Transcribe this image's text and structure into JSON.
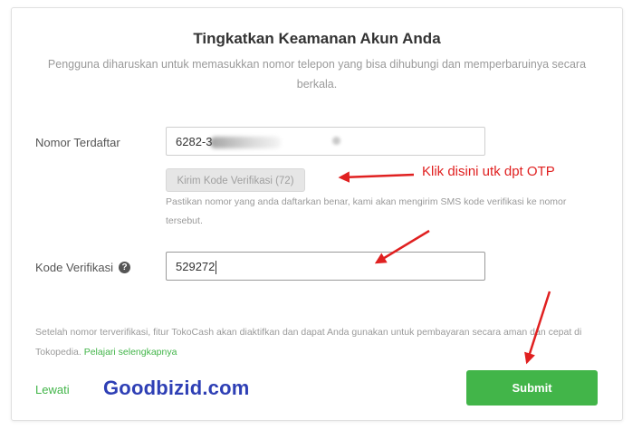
{
  "header": {
    "title": "Tingkatkan Keamanan Akun Anda",
    "subtitle": "Pengguna diharuskan untuk memasukkan nomor telepon yang bisa dihubungi dan memperbaruinya secara berkala."
  },
  "phone": {
    "label": "Nomor Terdaftar",
    "value": "6282-3"
  },
  "send_code": {
    "label": "Kirim Kode Verifikasi (72)",
    "hint": "Pastikan nomor yang anda daftarkan benar, kami akan mengirim SMS kode verifikasi ke nomor tersebut."
  },
  "code": {
    "label": "Kode Verifikasi",
    "help_icon": "question-circle-icon",
    "value": "529272"
  },
  "footnote": {
    "text": "Setelah nomor terverifikasi, fitur TokoCash akan diaktifkan dan dapat Anda gunakan untuk pembayaran secara aman dan cepat di Tokopedia. ",
    "link": "Pelajari selengkapnya"
  },
  "actions": {
    "skip_label": "Lewati",
    "submit_label": "Submit"
  },
  "annotation": {
    "text": "Klik disini utk dpt OTP",
    "color": "#e02020"
  },
  "watermark": "Goodbizid.com",
  "colors": {
    "accent": "#42b549",
    "watermark": "#2e3fb5"
  }
}
